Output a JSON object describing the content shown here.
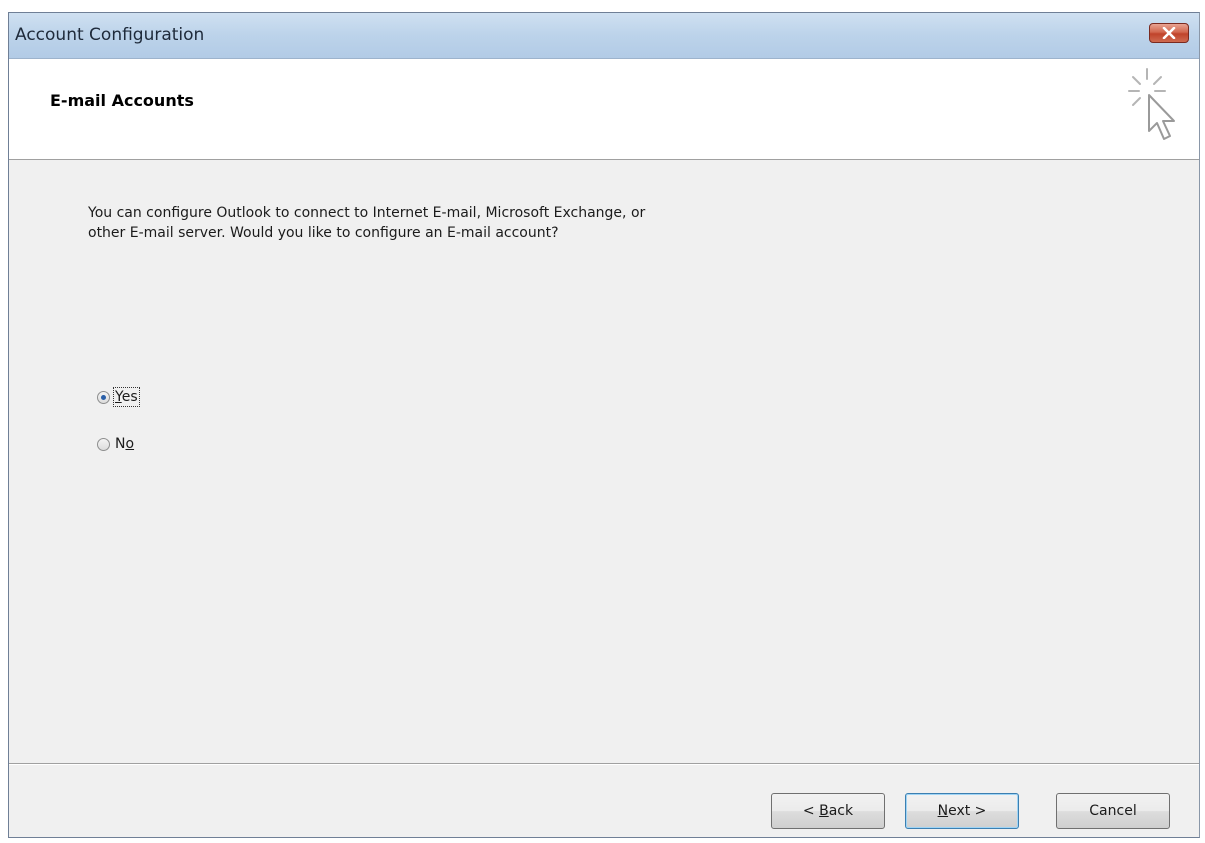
{
  "window": {
    "title": "Account Configuration"
  },
  "header": {
    "title": "E-mail Accounts",
    "icon": "wizard-cursor-icon"
  },
  "content": {
    "intro_line1": "You can configure Outlook to connect to Internet E-mail, Microsoft Exchange, or",
    "intro_line2": "other E-mail server. Would you like to configure an E-mail account?",
    "options": [
      {
        "label_prefix": "",
        "label_mnemonic": "Y",
        "label_suffix": "es",
        "selected": true
      },
      {
        "label_prefix": "N",
        "label_mnemonic": "o",
        "label_suffix": "",
        "selected": false
      }
    ]
  },
  "buttons": {
    "back_prefix": "< ",
    "back_mnemonic": "B",
    "back_suffix": "ack",
    "next_mnemonic": "N",
    "next_suffix": "ext >",
    "cancel": "Cancel"
  },
  "colors": {
    "titlebar": "#bcd3ea",
    "close": "#c0432b",
    "dialog_bg": "#f0f0f0",
    "radio_dot": "#2a5fa8"
  }
}
